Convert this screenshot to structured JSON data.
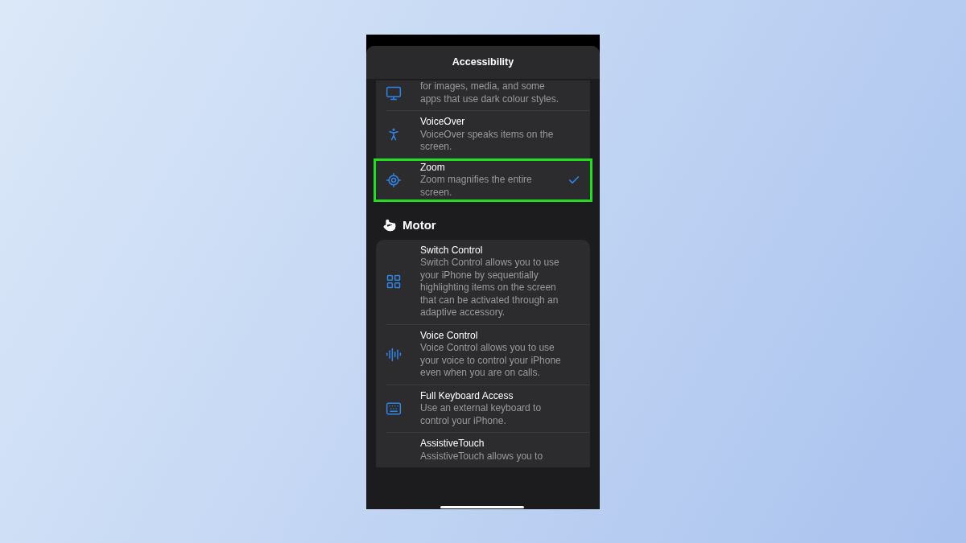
{
  "nav": {
    "title": "Accessibility"
  },
  "sections": [
    {
      "rows": [
        {
          "description": "for images, media, and some apps that use dark colour styles.",
          "selected": false
        },
        {
          "title": "VoiceOver",
          "description": "VoiceOver speaks items on the screen.",
          "selected": false
        },
        {
          "title": "Zoom",
          "description": "Zoom magnifies the entire screen.",
          "selected": true
        }
      ]
    },
    {
      "heading": "Motor",
      "rows": [
        {
          "title": "Switch Control",
          "description": "Switch Control allows you to use your iPhone by sequentially highlighting items on the screen that can be activated through an adaptive accessory.",
          "selected": false
        },
        {
          "title": "Voice Control",
          "description": "Voice Control allows you to use your voice to control your iPhone even when you are on calls.",
          "selected": false
        },
        {
          "title": "Full Keyboard Access",
          "description": "Use an external keyboard to control your iPhone.",
          "selected": false
        },
        {
          "title": "AssistiveTouch",
          "description": "AssistiveTouch allows you to",
          "selected": false
        }
      ]
    }
  ]
}
